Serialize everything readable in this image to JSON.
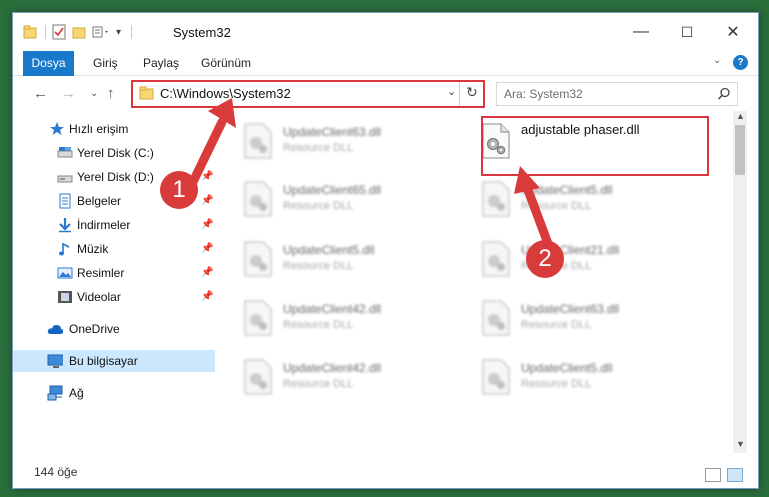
{
  "window": {
    "title": "System32"
  },
  "ribbon": {
    "tabs": [
      "Dosya",
      "Giriş",
      "Paylaş",
      "Görünüm"
    ],
    "help": "?"
  },
  "window_controls": {
    "minimize": "—",
    "maximize": "☐",
    "close": "✕"
  },
  "address": {
    "path": "C:\\Windows\\System32"
  },
  "search": {
    "placeholder": "Ara: System32"
  },
  "sidebar": {
    "items": [
      {
        "label": "Hızlı erişim"
      },
      {
        "label": "Yerel Disk (C:)"
      },
      {
        "label": "Yerel Disk (D:)"
      },
      {
        "label": "Belgeler"
      },
      {
        "label": "İndirmeler"
      },
      {
        "label": "Müzik"
      },
      {
        "label": "Resimler"
      },
      {
        "label": "Videolar"
      },
      {
        "label": "OneDrive"
      },
      {
        "label": "Bu bilgisayar"
      },
      {
        "label": "Ağ"
      }
    ]
  },
  "files": [
    {
      "name": "UpdateClient63.dll",
      "type": "Resource DLL"
    },
    {
      "name": "adjustable phaser.dll",
      "type": ""
    },
    {
      "name": "UpdateClient65.dll",
      "type": "Resource DLL"
    },
    {
      "name": "UpdateClient5.dll",
      "type": "Resource DLL"
    },
    {
      "name": "UpdateClient5.dll",
      "type": "Resource DLL"
    },
    {
      "name": "UpdateClient21.dll",
      "type": "Resource DLL"
    },
    {
      "name": "UpdateClient42.dll",
      "type": "Resource DLL"
    },
    {
      "name": "UpdateClient63.dll",
      "type": "Resource DLL"
    },
    {
      "name": "UpdateClient42.dll",
      "type": "Resource DLL"
    },
    {
      "name": "UpdateClient5.dll",
      "type": "Resource DLL"
    }
  ],
  "status": {
    "count": "144 öğe"
  },
  "markers": {
    "one": "1",
    "two": "2"
  },
  "colors": {
    "accent": "#1979ca",
    "highlight": "#d9363e",
    "selected": "#cce8ff"
  }
}
